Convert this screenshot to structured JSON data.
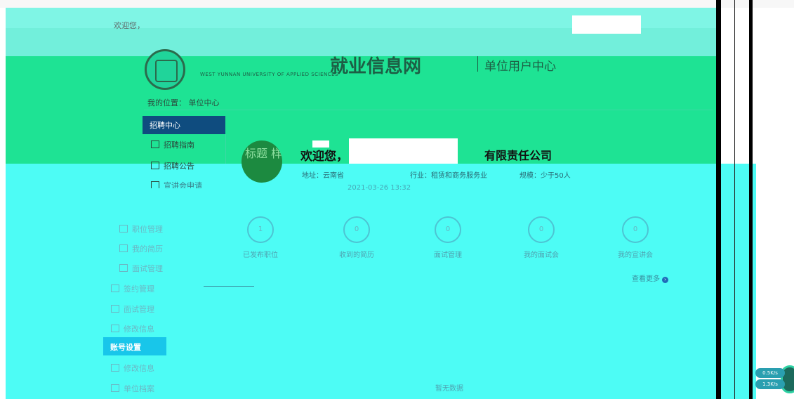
{
  "topbar": {
    "welcome_text": "欢迎您，"
  },
  "header": {
    "site_name": "就业信息网",
    "site_en": "WEST YUNNAN UNIVERSITY OF APPLIED SCIENCES",
    "center_title": "单位用户中心"
  },
  "breadcrumb": {
    "label": "我的位置：",
    "current": "单位中心"
  },
  "sidebar": {
    "active": "招聘中心",
    "items": [
      "招聘指南",
      "招聘公告",
      "宣讲会申请"
    ],
    "items_lower": [
      "职位管理",
      "我的简历",
      "面试管理",
      "签约管理",
      "面试管理",
      "修改信息"
    ],
    "account_section": "账号设置",
    "account_items": [
      "修改信息",
      "单位档案"
    ]
  },
  "company": {
    "welcome": "欢迎您，",
    "name_suffix": "有限责任公司",
    "avatar_text": "标题 样手",
    "address_label": "地址：",
    "address_value": "云南省",
    "industry_label": "行业：",
    "industry_value": "租赁和商务服务业",
    "scale_label": "规模：",
    "scale_value": "少于50人",
    "date": "2021-03-26 13:32"
  },
  "stats": [
    {
      "value": "1",
      "label": "已发布职位"
    },
    {
      "value": "0",
      "label": "收到的简历"
    },
    {
      "value": "0",
      "label": "面试管理"
    },
    {
      "value": "0",
      "label": "我的面试会"
    },
    {
      "value": "0",
      "label": "我的宣讲会"
    }
  ],
  "list": {
    "view_more": "查看更多",
    "empty_text": "暂无数据"
  },
  "speed_widget": {
    "upload": "0.5K/s",
    "download": "1.3K/s"
  },
  "colors": {
    "mint": "#7ff5e5",
    "green": "#1ee394",
    "cyan": "#4dfcf5",
    "nav_blue": "#0f4c7f",
    "account_bar": "#18c6ea"
  }
}
